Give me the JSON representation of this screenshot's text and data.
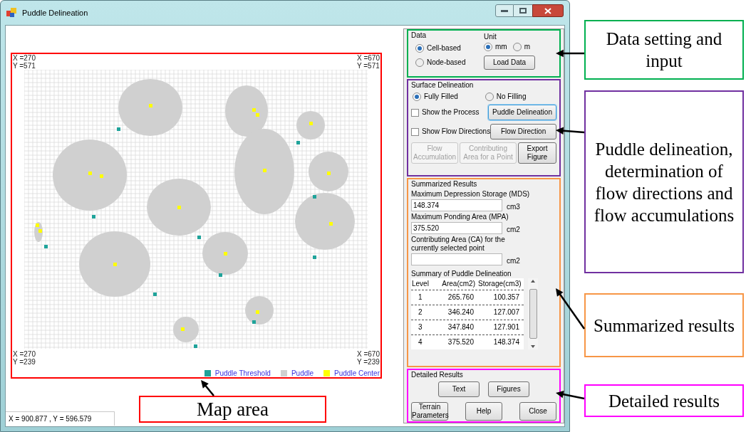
{
  "window": {
    "title": "Puddle Delineation"
  },
  "map": {
    "top_labels": [
      {
        "x": "X =270",
        "y": "Y =571"
      },
      {
        "x": "X =670",
        "y": "Y =571"
      }
    ],
    "bottom_labels": [
      {
        "x": "X =270",
        "y": "Y =239"
      },
      {
        "x": "X =670",
        "y": "Y =239"
      }
    ],
    "legend": [
      {
        "label": "Puddle Threshold",
        "color": "#1fa39a"
      },
      {
        "label": "Puddle",
        "color": "#d0d0d0"
      },
      {
        "label": "Puddle Center",
        "color": "#ffff00"
      }
    ]
  },
  "status_bar": "X = 900.877 ,  Y = 596.579",
  "data_group": {
    "title": "Data",
    "options": [
      {
        "label": "Cell-based",
        "selected": true
      },
      {
        "label": "Node-based",
        "selected": false
      }
    ],
    "unit": {
      "title": "Unit",
      "options": [
        {
          "label": "mm",
          "selected": true
        },
        {
          "label": "m",
          "selected": false
        }
      ]
    },
    "load_button": "Load Data"
  },
  "surface_group": {
    "title": "Surface Delineation",
    "modes": [
      {
        "label": "Fully Filled",
        "selected": true
      },
      {
        "label": "No Filling",
        "selected": false
      }
    ],
    "checks": [
      {
        "label": "Show the Process",
        "checked": false,
        "button": "Puddle Delineation",
        "focused": true
      },
      {
        "label": "Show Flow Directions",
        "checked": false,
        "button": "Flow Direction",
        "focused": false
      }
    ],
    "buttons": [
      {
        "label": "Flow Accumulation",
        "disabled": true
      },
      {
        "label": "Contributing Area for a Point",
        "disabled": true
      },
      {
        "label": "Export Figure",
        "disabled": false
      }
    ]
  },
  "summary_group": {
    "title": "Summarized Results",
    "fields": [
      {
        "label": "Maximum Depression Storage (MDS)",
        "value": "148.374",
        "unit": "cm3"
      },
      {
        "label": "Maximum Ponding Area (MPA)",
        "value": "375.520",
        "unit": "cm2"
      },
      {
        "label": "Contributing Area (CA) for the currently selected point",
        "unit": "cm2"
      }
    ],
    "table": {
      "title": "Summary of Puddle Delineation",
      "columns": [
        "Level",
        "Area(cm2)",
        "Storage(cm3)"
      ],
      "rows": [
        [
          "1",
          "265.760",
          "100.357"
        ],
        [
          "2",
          "346.240",
          "127.007"
        ],
        [
          "3",
          "347.840",
          "127.901"
        ],
        [
          "4",
          "375.520",
          "148.374"
        ]
      ]
    }
  },
  "detailed_group": {
    "title": "Detailed Results",
    "buttons": [
      "Text",
      "Figures"
    ],
    "bottom_buttons": [
      "Terrain Parameters",
      "Help",
      "Close"
    ]
  },
  "annotations": [
    {
      "text": "Data setting and input",
      "color": "#00b050"
    },
    {
      "text": "Puddle delineation, determination of flow directions and flow accumulations",
      "color": "#7030a0"
    },
    {
      "text": "Summarized results",
      "color": "#f79646"
    },
    {
      "text": "Map area",
      "color": "#ff0000"
    },
    {
      "text": "Detailed results",
      "color": "#ff00ff"
    }
  ]
}
